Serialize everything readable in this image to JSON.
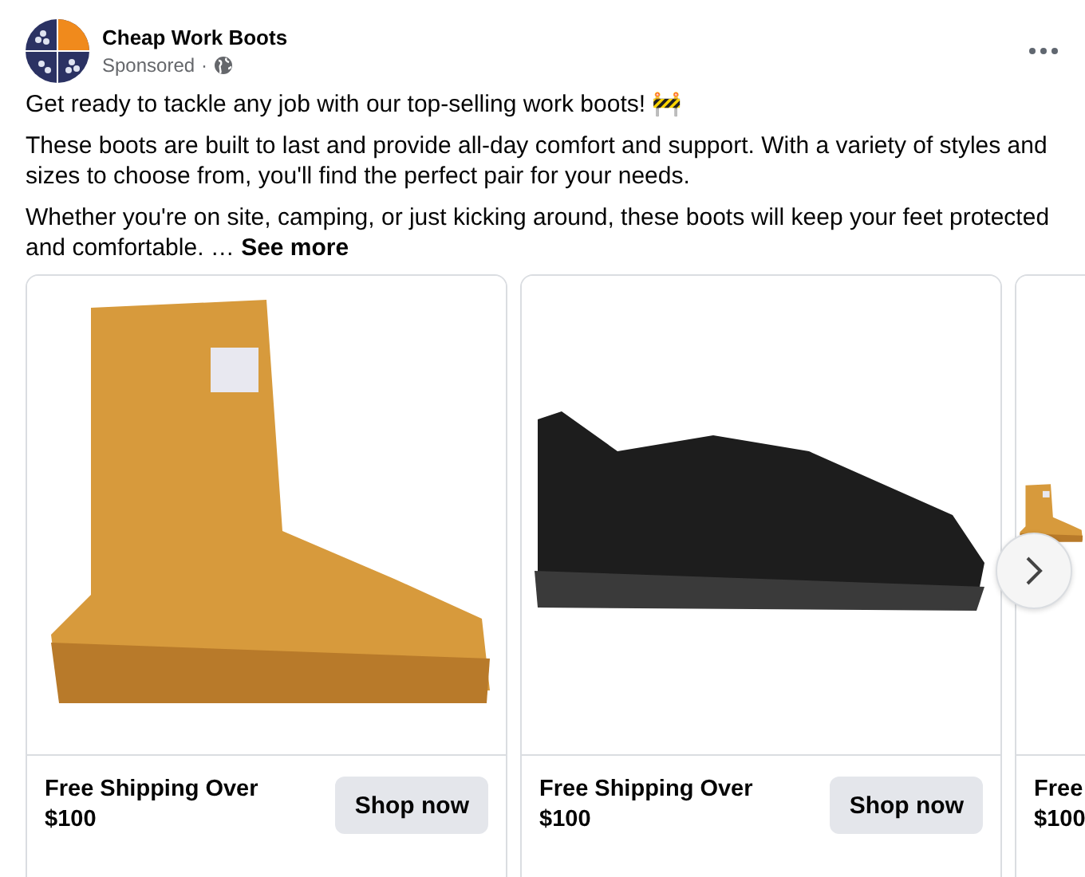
{
  "post": {
    "page_name": "Cheap Work Boots",
    "sponsored": "Sponsored",
    "separator": "·"
  },
  "paragraphs": [
    "Get ready to tackle any job with our top-selling work boots! 🚧",
    "These boots are built to last and provide all-day comfort and support. With a variety of styles and sizes to choose from, you'll find the perfect pair for your needs.",
    "Whether you're on site, camping, or just kicking around, these boots will keep your feet protected and comfortable."
  ],
  "ellipsis": "…",
  "see_more": "See more",
  "cards": [
    {
      "kind": "boot",
      "title_lines": [
        "Free Shipping Over",
        "$100"
      ],
      "button": "Shop now"
    },
    {
      "kind": "shoe",
      "title_lines": [
        "Free Shipping Over",
        "$100"
      ],
      "button": "Shop now"
    },
    {
      "kind": "boot",
      "title_lines": [
        "Free",
        "$100"
      ]
    }
  ]
}
